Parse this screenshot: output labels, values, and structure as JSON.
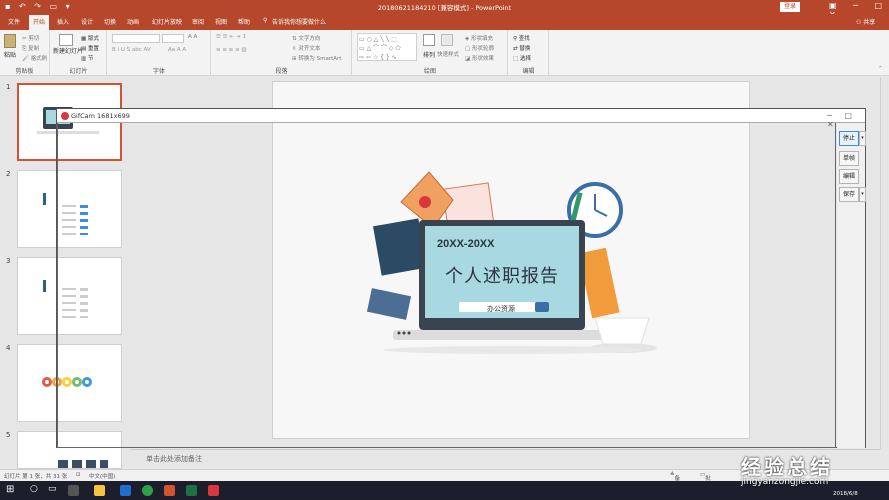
{
  "window": {
    "title": "20180621184210 [兼容模式] - PowerPoint",
    "login_label": "登录"
  },
  "tabs": [
    {
      "label": "文件"
    },
    {
      "label": "开始",
      "active": true
    },
    {
      "label": "插入"
    },
    {
      "label": "设计"
    },
    {
      "label": "切换"
    },
    {
      "label": "动画"
    },
    {
      "label": "幻灯片放映"
    },
    {
      "label": "审阅"
    },
    {
      "label": "视图"
    },
    {
      "label": "帮助"
    }
  ],
  "search_placeholder": "告诉我你想要做什么",
  "share_label": "共享",
  "ribbon": {
    "clipboard": {
      "label": "剪贴板",
      "paste": "粘贴",
      "cut": "剪切",
      "copy": "复制",
      "format_painter": "格式刷"
    },
    "slides": {
      "label": "幻灯片",
      "new_slide": "新建幻灯片",
      "layout": "版式",
      "reset": "重置",
      "section": "节"
    },
    "font": {
      "label": "字体"
    },
    "paragraph": {
      "label": "段落",
      "text_direction": "文字方向",
      "align_text": "对齐文本",
      "smartart": "转换为 SmartArt"
    },
    "drawing": {
      "label": "绘图",
      "arrange": "排列",
      "quick_styles": "快速样式",
      "shape_fill": "形状填充",
      "shape_outline": "形状轮廓",
      "shape_effects": "形状效果"
    },
    "editing": {
      "label": "编辑",
      "find": "查找",
      "replace": "替换",
      "select": "选择"
    }
  },
  "slides": [
    {
      "number": "1"
    },
    {
      "number": "2"
    },
    {
      "number": "3"
    },
    {
      "number": "4"
    },
    {
      "number": "5"
    }
  ],
  "slide_content": {
    "year_range": "20XX-20XX",
    "main_title": "个人述职报告",
    "subtitle": "办公资源"
  },
  "notes_placeholder": "单击此处添加备注",
  "status": {
    "slide_count": "幻灯片 第 1 张，共 31 张",
    "language": "中文(中国)",
    "notes": "备注",
    "comments": "批注"
  },
  "gifcam": {
    "title": "GifCam 1681x699",
    "buttons": {
      "stop": "停止",
      "frame": "单帧",
      "edit": "编辑",
      "save": "保存"
    }
  },
  "watermark": {
    "line1": "经验总结",
    "line2": "jingyanzongjie.com"
  },
  "taskbar": {
    "date": "2018/6/8"
  },
  "colors": {
    "ppt_accent": "#b7472a",
    "selection": "#d35230",
    "monitor_screen": "#a8d8e0",
    "monitor_frame": "#3a4450"
  }
}
